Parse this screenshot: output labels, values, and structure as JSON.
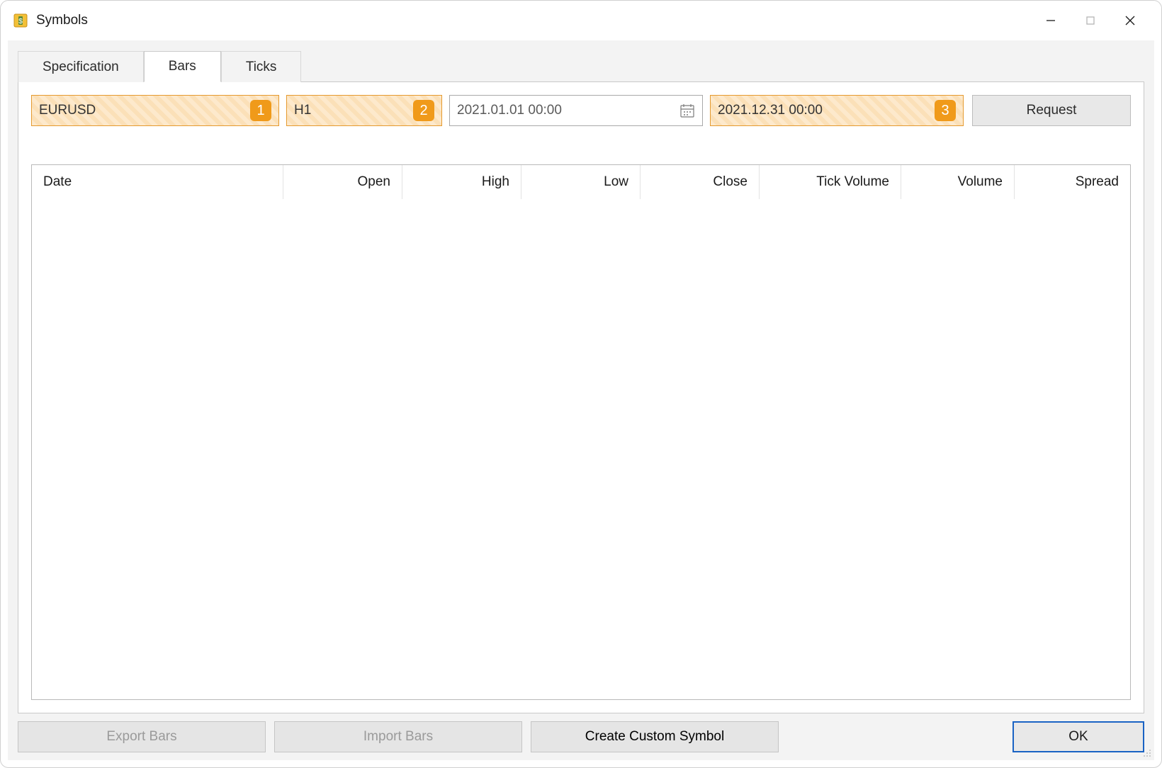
{
  "window": {
    "title": "Symbols"
  },
  "tabs": {
    "specification": "Specification",
    "bars": "Bars",
    "ticks": "Ticks",
    "active": "bars"
  },
  "filters": {
    "symbol": {
      "value": "EURUSD",
      "badge": "1"
    },
    "timeframe": {
      "value": "H1",
      "badge": "2"
    },
    "date_from": {
      "value": "2021.01.01 00:00"
    },
    "date_to": {
      "value": "2021.12.31 00:00",
      "badge": "3"
    },
    "request_label": "Request"
  },
  "table": {
    "columns": {
      "date": "Date",
      "open": "Open",
      "high": "High",
      "low": "Low",
      "close": "Close",
      "tick_volume": "Tick Volume",
      "volume": "Volume",
      "spread": "Spread"
    },
    "rows": []
  },
  "footer": {
    "export_bars": "Export Bars",
    "import_bars": "Import Bars",
    "create_symbol": "Create Custom Symbol",
    "ok": "OK"
  }
}
